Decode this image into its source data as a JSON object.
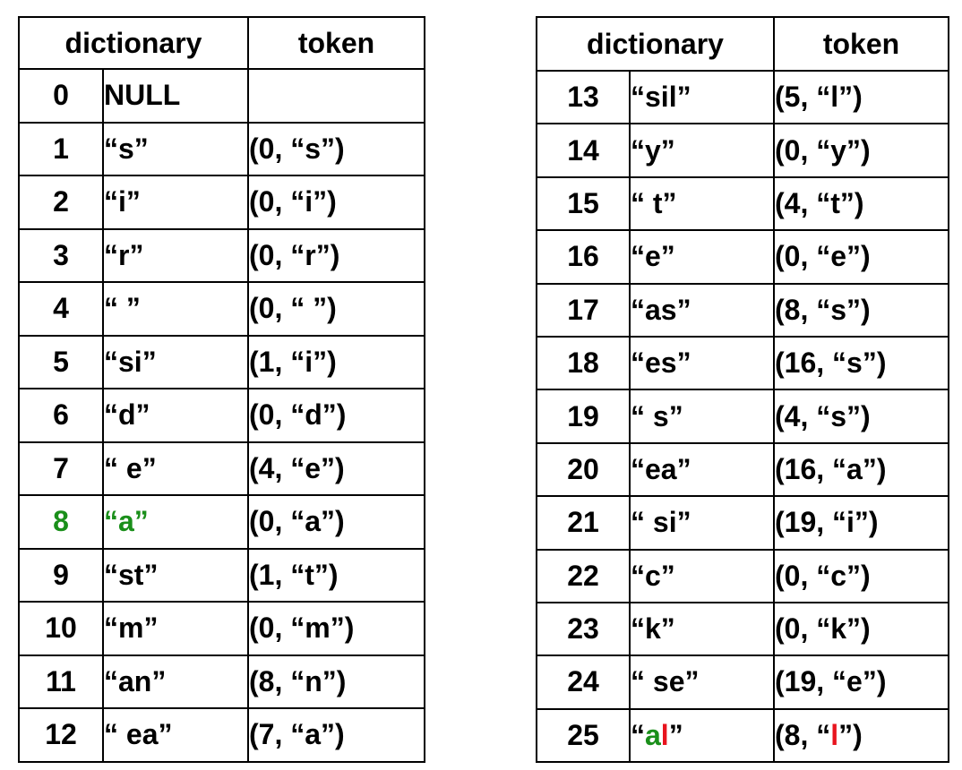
{
  "left_table": {
    "headers": {
      "dictionary": "dictionary",
      "token": "token"
    },
    "rows": [
      {
        "index": "0",
        "entry": "NULL",
        "token": ""
      },
      {
        "index": "1",
        "entry": "“s”",
        "token": "(0, “s”)"
      },
      {
        "index": "2",
        "entry": "“i”",
        "token": "(0, “i”)"
      },
      {
        "index": "3",
        "entry": "“r”",
        "token": "(0, “r”)"
      },
      {
        "index": "4",
        "entry": "“ ”",
        "token": "(0, “ ”)"
      },
      {
        "index": "5",
        "entry": "“si”",
        "token": "(1, “i”)"
      },
      {
        "index": "6",
        "entry": "“d”",
        "token": "(0, “d”)"
      },
      {
        "index": "7",
        "entry": "“ e”",
        "token": "(4, “e”)"
      },
      {
        "index": "8",
        "entry": "“a”",
        "token": "(0, “a”)"
      },
      {
        "index": "9",
        "entry": "“st”",
        "token": "(1, “t”)"
      },
      {
        "index": "10",
        "entry": "“m”",
        "token": "(0, “m”)"
      },
      {
        "index": "11",
        "entry": "“an”",
        "token": "(8, “n”)"
      },
      {
        "index": "12",
        "entry": "“ ea”",
        "token": "(7, “a”)"
      }
    ]
  },
  "right_table": {
    "headers": {
      "dictionary": "dictionary",
      "token": "token"
    },
    "rows": [
      {
        "index": "13",
        "entry": "“sil”",
        "token": "(5, “l”)"
      },
      {
        "index": "14",
        "entry": "“y”",
        "token": "(0, “y”)"
      },
      {
        "index": "15",
        "entry": "“ t”",
        "token": "(4, “t”)"
      },
      {
        "index": "16",
        "entry": "“e”",
        "token": "(0, “e”)"
      },
      {
        "index": "17",
        "entry": "“as”",
        "token": "(8, “s”)"
      },
      {
        "index": "18",
        "entry": "“es”",
        "token": "(16, “s”)"
      },
      {
        "index": "19",
        "entry": "“ s”",
        "token": "(4, “s”)"
      },
      {
        "index": "20",
        "entry": "“ea”",
        "token": "(16, “a”)"
      },
      {
        "index": "21",
        "entry": "“ si”",
        "token": "(19, “i”)"
      },
      {
        "index": "22",
        "entry": "“c”",
        "token": "(0, “c”)"
      },
      {
        "index": "23",
        "entry": "“k”",
        "token": "(0, “k”)"
      },
      {
        "index": "24",
        "entry": "“ se”",
        "token": "(19, “e”)"
      }
    ],
    "last_row": {
      "index": "25",
      "entry_open": "“",
      "entry_prefix": "a",
      "entry_new_char": "l",
      "entry_close": "”",
      "token_open": "(8, “",
      "token_char": "l",
      "token_close": "”)"
    }
  },
  "colors": {
    "prefix_highlight": "#1a8f1a",
    "new_char_highlight": "#e8141e"
  },
  "highlight": {
    "left_row_index": "8"
  }
}
